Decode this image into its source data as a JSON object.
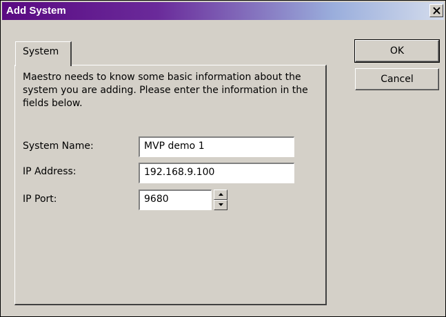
{
  "window": {
    "title": "Add System",
    "close_glyph": "✕"
  },
  "tabs": [
    {
      "label": "System",
      "selected": true
    }
  ],
  "main": {
    "instructions": "Maestro needs to know some basic information about the system you are adding.  Please enter the information in the fields below.",
    "fields": {
      "system_name": {
        "label": "System Name:",
        "value": "MVP demo 1"
      },
      "ip_address": {
        "label": "IP Address:",
        "value": "192.168.9.100"
      },
      "ip_port": {
        "label": "IP Port:",
        "value": "9680"
      }
    }
  },
  "buttons": {
    "ok": "OK",
    "cancel": "Cancel"
  },
  "icons": {
    "close": "close-icon",
    "spin_up": "triangle-up-icon",
    "spin_down": "triangle-down-icon"
  },
  "colors": {
    "title_gradient_start": "#5a0a82",
    "title_gradient_end": "#d4dcec",
    "dialog_face": "#d4d0c8"
  }
}
